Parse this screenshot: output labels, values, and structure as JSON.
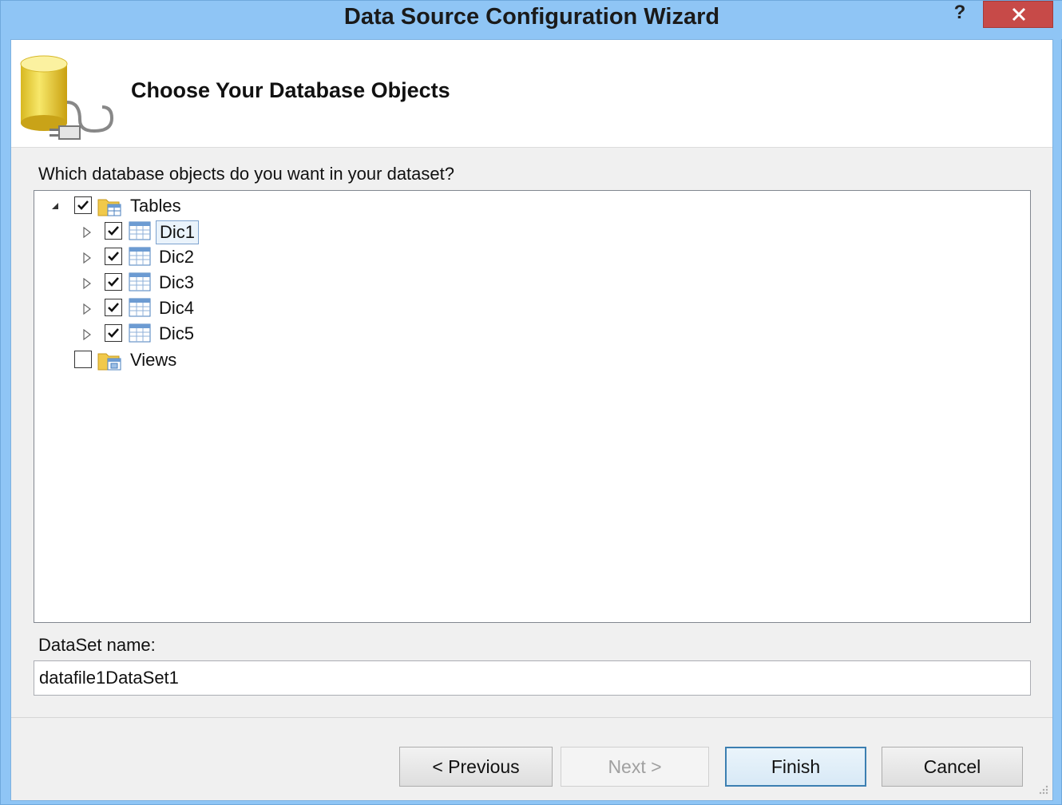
{
  "window": {
    "title": "Data Source Configuration Wizard",
    "help_glyph": "?"
  },
  "header": {
    "page_title": "Choose Your Database Objects"
  },
  "objects": {
    "question": "Which database objects do you want in your dataset?",
    "tree": [
      {
        "label": "Tables",
        "checked": true,
        "expanded": true,
        "level": 0
      },
      {
        "label": "Dic1",
        "checked": true,
        "expanded": false,
        "level": 1,
        "selected": true
      },
      {
        "label": "Dic2",
        "checked": true,
        "expanded": false,
        "level": 1
      },
      {
        "label": "Dic3",
        "checked": true,
        "expanded": false,
        "level": 1
      },
      {
        "label": "Dic4",
        "checked": true,
        "expanded": false,
        "level": 1
      },
      {
        "label": "Dic5",
        "checked": true,
        "expanded": false,
        "level": 1
      },
      {
        "label": "Views",
        "checked": false,
        "expanded": false,
        "level": 0
      }
    ]
  },
  "dataset": {
    "label": "DataSet name:",
    "value": "datafile1DataSet1"
  },
  "buttons": {
    "previous": "< Previous",
    "next": "Next >",
    "finish": "Finish",
    "cancel": "Cancel"
  },
  "colors": {
    "titlebar": "#8fc5f5",
    "close_button": "#c74a48",
    "selection_border": "#7da2ce"
  }
}
